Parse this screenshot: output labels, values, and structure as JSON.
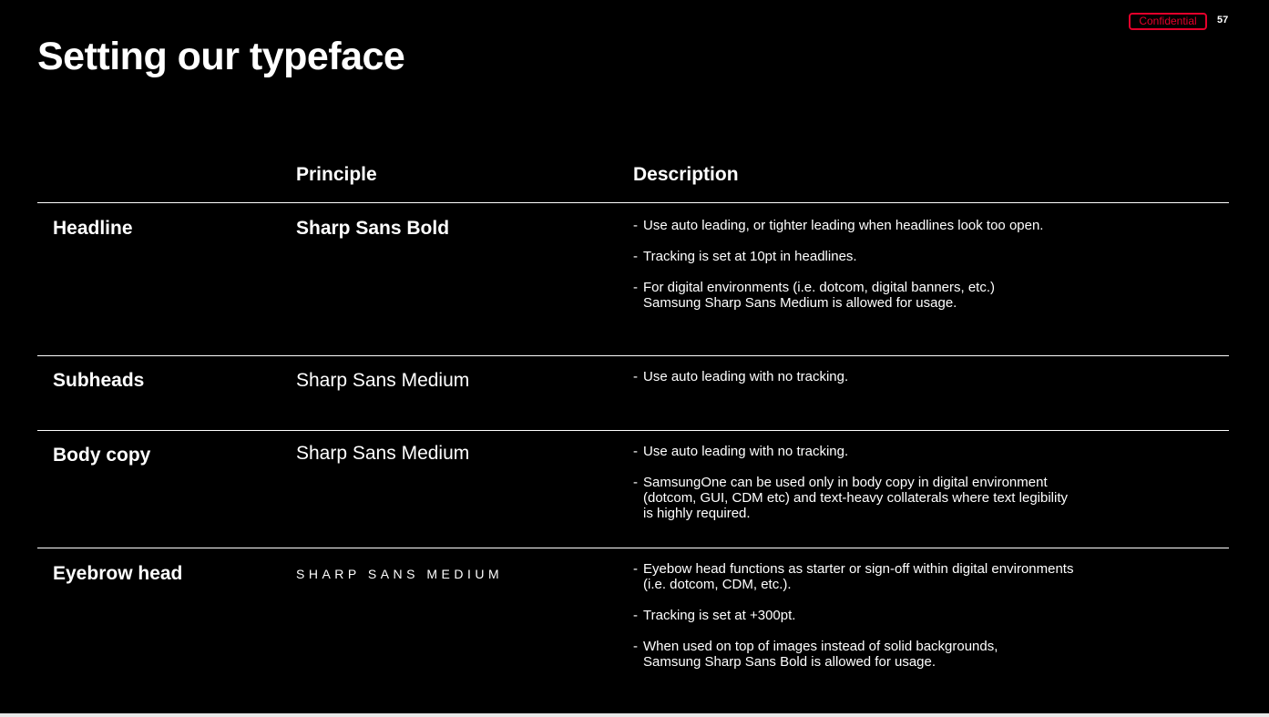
{
  "slide": {
    "title": "Setting our typeface",
    "confidential": "Confidential",
    "page_number": "57",
    "accent_color": "#e4002b"
  },
  "table": {
    "headers": {
      "principle": "Principle",
      "description": "Description"
    },
    "rows": [
      {
        "label": "Headline",
        "principle": "Sharp Sans Bold",
        "description": [
          "Use auto leading, or tighter leading when headlines look too open.",
          "Tracking is set at 10pt in headlines.",
          "For digital environments (i.e. dotcom, digital banners, etc.)\nSamsung Sharp Sans Medium is allowed for usage."
        ]
      },
      {
        "label": "Subheads",
        "principle": "Sharp Sans Medium",
        "description": [
          "Use auto leading with no tracking."
        ]
      },
      {
        "label": "Body copy",
        "principle": "Sharp Sans Medium",
        "description": [
          "Use auto leading with no tracking.",
          "SamsungOne can be used only in body copy in digital environment\n(dotcom, GUI, CDM etc) and text-heavy collaterals where text legibility\nis highly required."
        ]
      },
      {
        "label": "Eyebrow head",
        "principle": "SHARP SANS MEDIUM",
        "description": [
          "Eyebow head functions as starter or sign-off within digital environments\n(i.e. dotcom, CDM, etc.).",
          "Tracking is set at +300pt.",
          "When used on top of images instead of solid backgrounds,\nSamsung Sharp Sans Bold is allowed for usage."
        ]
      }
    ]
  }
}
